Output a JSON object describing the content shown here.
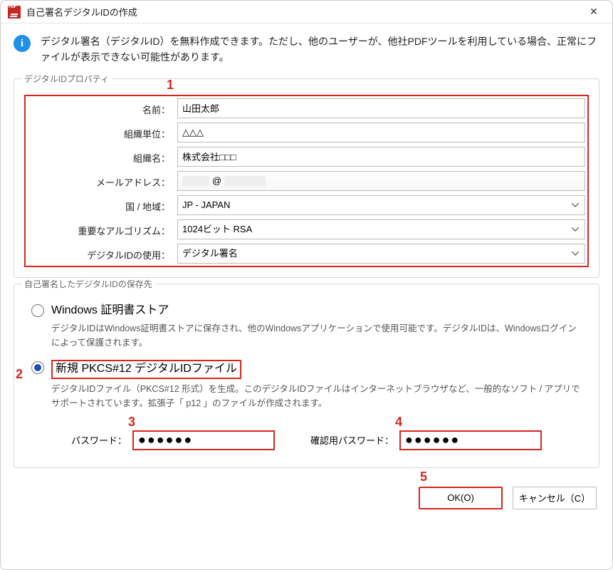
{
  "title": "自己署名デジタルIDの作成",
  "info_text": "デジタル署名（デジタルID）を無料作成できます。ただし、他のユーザーが、他社PDFツールを利用している場合、正常にファイルが表示できない可能性があります。",
  "group1": {
    "title": "デジタルIDプロパティ",
    "fields": {
      "name_label": "名前：",
      "name_value": "山田太郎",
      "org_unit_label": "組織単位：",
      "org_unit_value": "△△△",
      "org_name_label": "組織名：",
      "org_name_value": "株式会社□□□",
      "email_label": "メールアドレス：",
      "email_at": "@",
      "country_label": "国 / 地域：",
      "country_value": "JP - JAPAN",
      "algo_label": "重要なアルゴリズム：",
      "algo_value": "1024ビット RSA",
      "usage_label": "デジタルIDの使用：",
      "usage_value": "デジタル署名"
    }
  },
  "group2": {
    "title": "自己署名したデジタルIDの保存先",
    "option1": {
      "title": "Windows 証明書ストア",
      "desc": "デジタルIDはWindows証明書ストアに保存され、他のWindowsアプリケーションで使用可能です。デジタルIDは、Windowsログインによって保護されます。"
    },
    "option2": {
      "title": "新規 PKCS#12 デジタルIDファイル",
      "desc": "デジタルIDファイル（PKCS#12 形式）を生成。このデジタルIDファイルはインターネットブラウザなど、一般的なソフト / アプリでサポートされています。拡張子「 p12 」のファイルが作成されます。"
    },
    "pwd_label": "パスワード：",
    "pwd_value": "●●●●●●",
    "pwd_confirm_label": "確認用パスワード：",
    "pwd_confirm_value": "●●●●●●"
  },
  "buttons": {
    "ok": "OK(O)",
    "cancel": "キャンセル（C）"
  },
  "annotations": {
    "a1": "1",
    "a2": "2",
    "a3": "3",
    "a4": "4",
    "a5": "5"
  }
}
